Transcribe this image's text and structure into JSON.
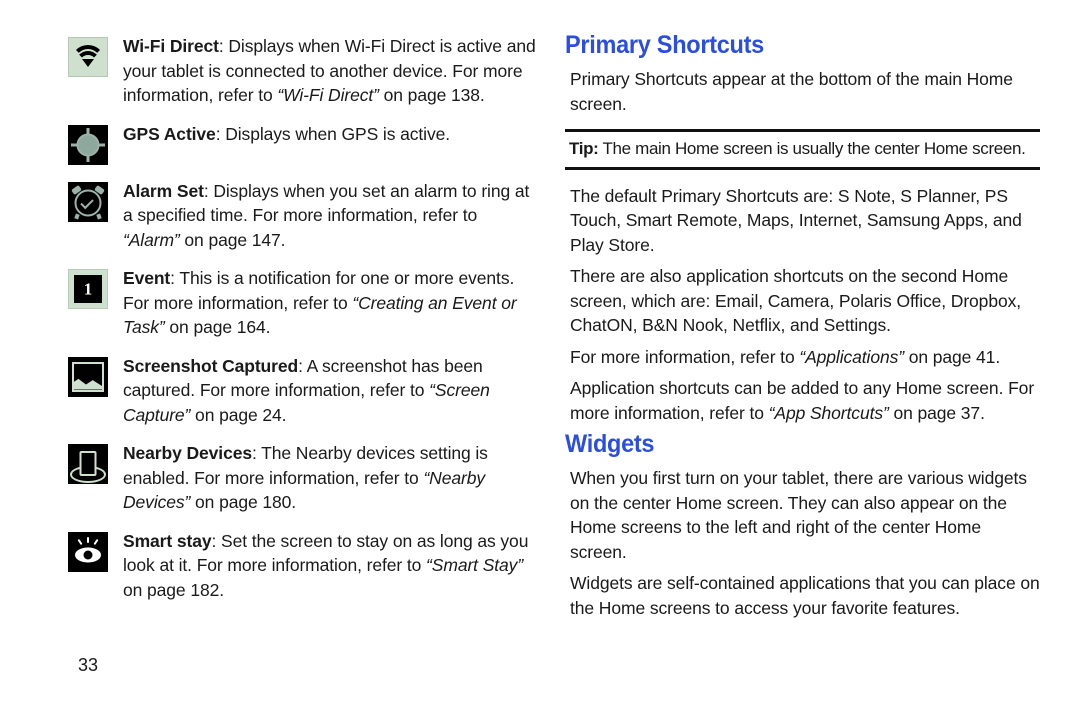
{
  "document": {
    "page_number": "33"
  },
  "left_column": {
    "entries": [
      {
        "icon": "wifi-direct-icon",
        "term": "Wi-Fi Direct",
        "body_1": ": Displays when Wi-Fi Direct is active and your tablet is connected to another device. For more information, refer to ",
        "reference": "“Wi-Fi Direct”",
        "body_2": " on page 138."
      },
      {
        "icon": "gps-active-icon",
        "term": "GPS Active",
        "body_1": ": Displays when GPS is active.",
        "reference": "",
        "body_2": ""
      },
      {
        "icon": "alarm-set-icon",
        "term": "Alarm Set",
        "body_1": ": Displays when you set an alarm to ring at a specified time. For more information, refer to ",
        "reference": "“Alarm”",
        "body_2": " on page 147."
      },
      {
        "icon": "event-icon",
        "term": "Event",
        "body_1": ": This is a notification for one or more events. For more information, refer to ",
        "reference": "“Creating an Event or Task”",
        "body_2": " on page 164."
      },
      {
        "icon": "screenshot-captured-icon",
        "term": "Screenshot Captured",
        "body_1": ": A screenshot has been captured. For more information, refer to ",
        "reference": "“Screen Capture”",
        "body_2": " on page 24."
      },
      {
        "icon": "nearby-devices-icon",
        "term": "Nearby Devices",
        "body_1": ": The Nearby devices setting is enabled. For more information, refer to ",
        "reference": "“Nearby Devices”",
        "body_2": " on page 180."
      },
      {
        "icon": "smart-stay-icon",
        "term": "Smart stay",
        "body_1": ": Set the screen to stay on as long as you look at it. For more information, refer to ",
        "reference": "“Smart Stay”",
        "body_2": " on page 182."
      }
    ]
  },
  "right_column": {
    "heading_primary_shortcuts": "Primary Shortcuts",
    "para_intro": "Primary Shortcuts appear at the bottom of the main Home screen.",
    "tip": {
      "label": "Tip:",
      "text": " The main Home screen is usually the center Home screen."
    },
    "para_defaults": "The default Primary Shortcuts are: S Note, S Planner, PS Touch, Smart Remote, Maps, Internet, Samsung Apps, and Play Store.",
    "para_second_home": "There are also application shortcuts on the second Home screen, which are: Email, Camera, Polaris Office, Dropbox, ChatON, B&N Nook, Netflix, and Settings.",
    "para_applications_pre": "For more information, refer to ",
    "para_applications_ref": "“Applications”",
    "para_applications_post": " on page 41.",
    "para_appshortcuts_pre": "Application shortcuts can be added to any Home screen. For more information, refer to ",
    "para_appshortcuts_ref": "“App Shortcuts”",
    "para_appshortcuts_post": " on page 37.",
    "heading_widgets": "Widgets",
    "para_widgets_1": "When you first turn on your tablet, there are various widgets on the center Home screen. They can also appear on the Home screens to the left and right of the center Home screen.",
    "para_widgets_2": "Widgets are self-contained applications that you can place on the Home screens to access your favorite features."
  },
  "colors": {
    "heading_blue": "#2b4ee0",
    "icon_green": "#cfe0cf",
    "icon_black": "#000000",
    "text": "#1a1a1a"
  }
}
